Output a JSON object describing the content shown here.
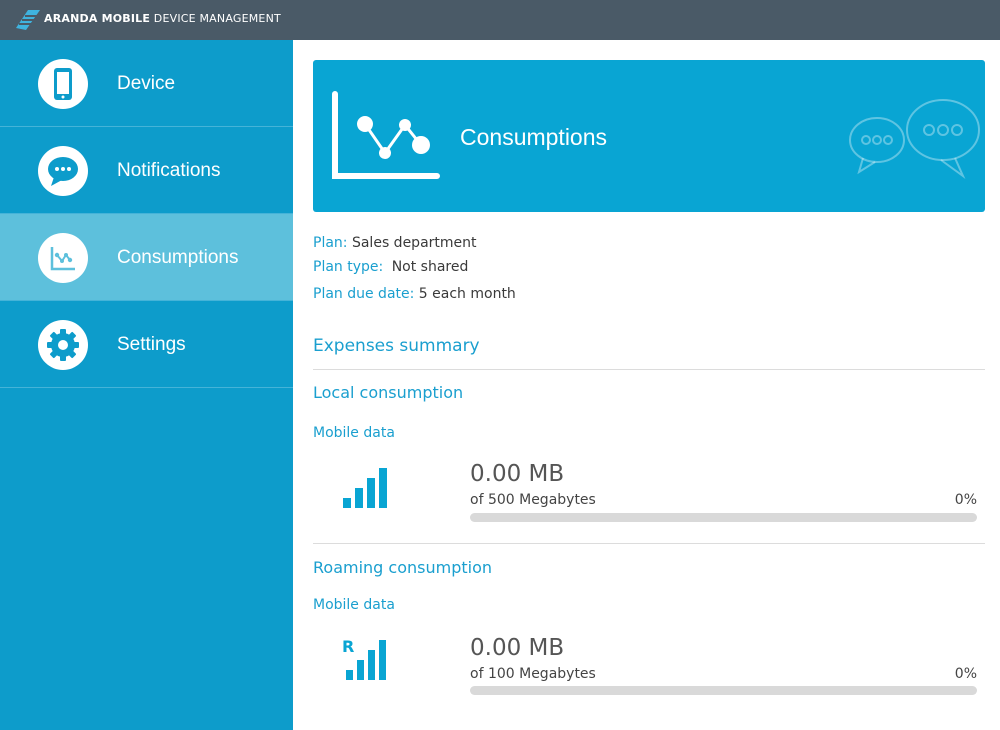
{
  "header": {
    "brand_bold": "ARANDA MOBILE",
    "brand_rest": " DEVICE MANAGEMENT",
    "logo_icon": "aranda-logo-icon"
  },
  "sidebar": {
    "items": [
      {
        "label": "Device",
        "icon": "phone-icon",
        "active": false
      },
      {
        "label": "Notifications",
        "icon": "chat-bubble-icon",
        "active": false
      },
      {
        "label": "Consumptions",
        "icon": "line-chart-icon",
        "active": true
      },
      {
        "label": "Settings",
        "icon": "gear-icon",
        "active": false
      }
    ]
  },
  "banner": {
    "title": "Consumptions",
    "icon": "line-chart-icon",
    "decoration": "speech-bubbles-icon"
  },
  "plan": {
    "plan_label": "Plan:",
    "plan_value": "Sales department",
    "type_label": "Plan type:",
    "type_value": "Not shared",
    "due_label": "Plan due date:",
    "due_value": "5 each month"
  },
  "expenses": {
    "title": "Expenses summary",
    "local": {
      "title": "Local consumption",
      "category": "Mobile data",
      "icon": "signal-bars-icon",
      "value": "0.00 MB",
      "of_text": "of 500 Megabytes",
      "percent_text": "0%",
      "percent": 0
    },
    "roaming": {
      "title": "Roaming consumption",
      "category": "Mobile data",
      "icon": "roaming-signal-icon",
      "roaming_letter": "R",
      "value": "0.00 MB",
      "of_text": "of 100 Megabytes",
      "percent_text": "0%",
      "percent": 0
    }
  },
  "colors": {
    "topbar": "#4a5a67",
    "sidebar": "#0d9ccb",
    "sidebar_active": "#5dc0dc",
    "accent": "#09a5d3",
    "link_text": "#1a9fcf",
    "bar_track": "#d9d9d9"
  }
}
